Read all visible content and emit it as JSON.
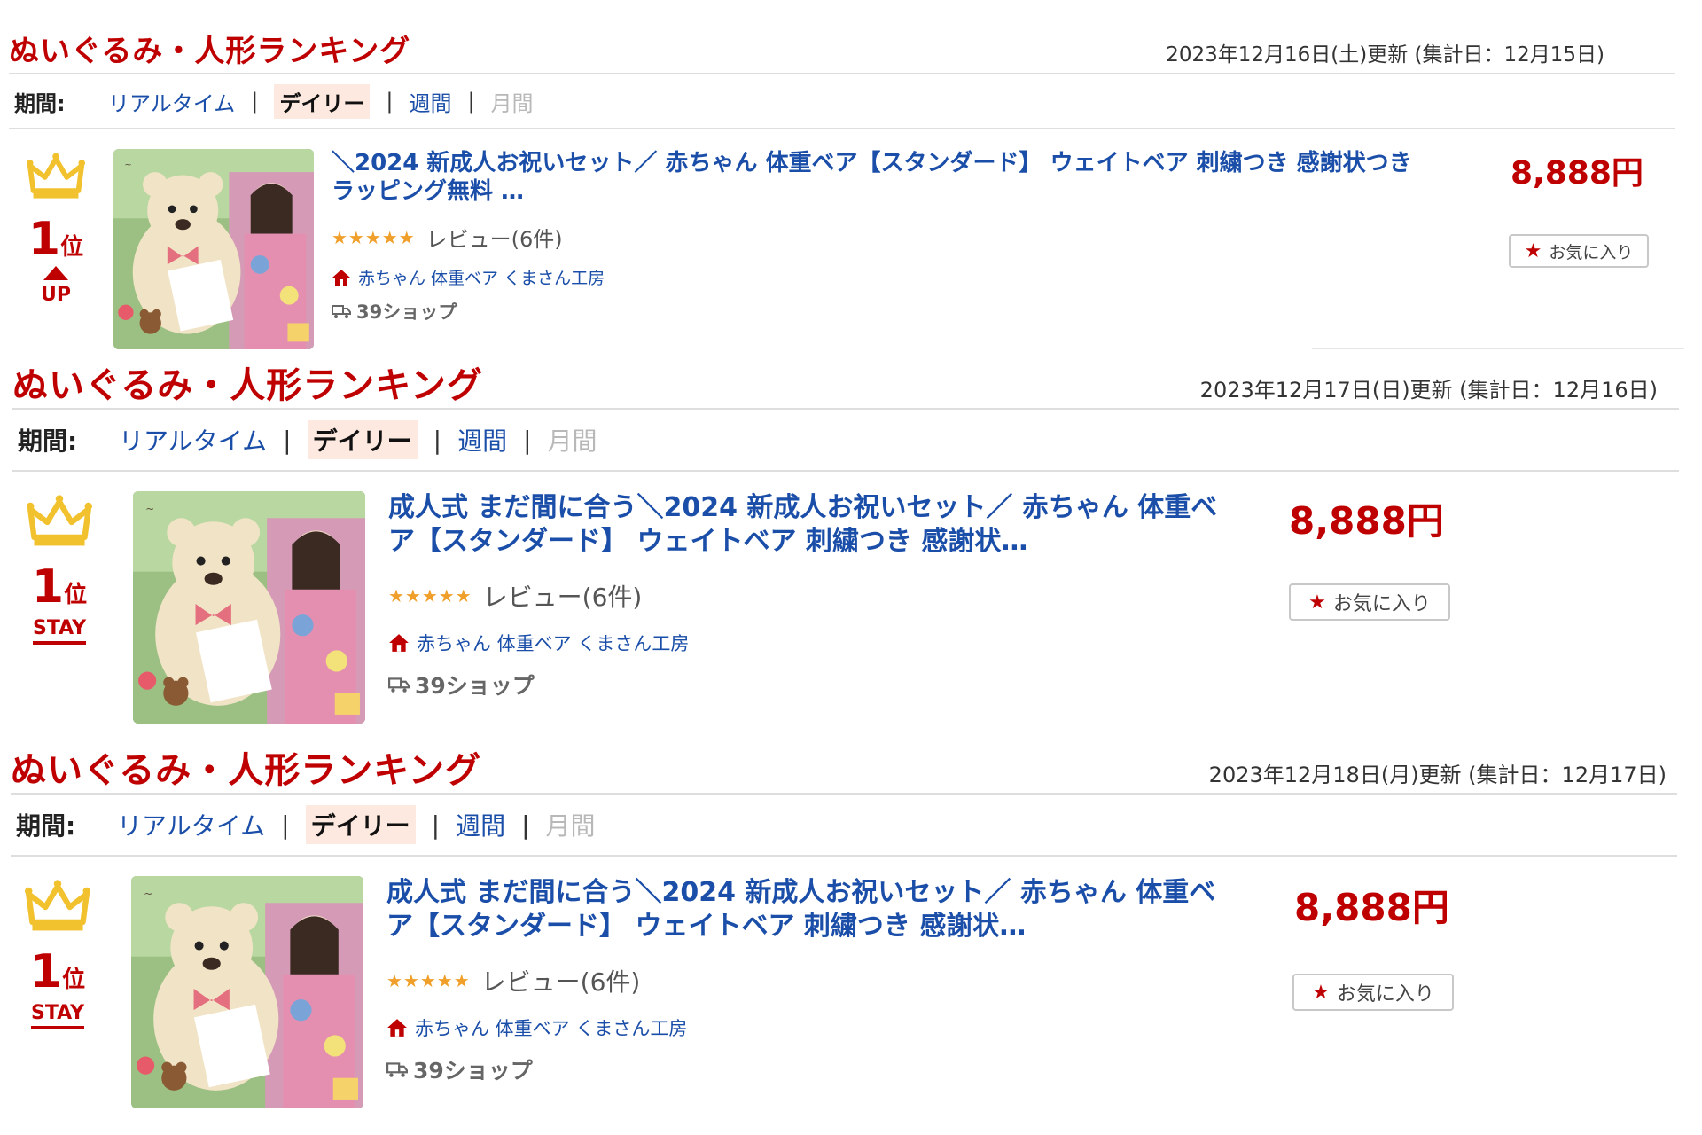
{
  "rankings": [
    {
      "title": "ぬいぐるみ・人形ランキング",
      "updated": "2023年12月16日(土)更新 (集計日：12月15日)",
      "period_label": "期間:",
      "tabs": [
        "リアルタイム",
        "デイリー",
        "週間",
        "月間"
      ],
      "item": {
        "rank": "1",
        "rank_unit": "位",
        "movement": "UP",
        "name": "＼2024 新成人お祝いセット／ 赤ちゃん 体重ベア【スタンダード】 ウェイトベア 刺繍つき 感謝状つき ラッピング無料 …",
        "stars": "★★★★★",
        "review": "レビュー(6件)",
        "shop": "赤ちゃん 体重ベア くまさん工房",
        "shipping": "39ショップ",
        "price": "8,888円",
        "favorite": "お気に入り"
      }
    },
    {
      "title": "ぬいぐるみ・人形ランキング",
      "updated": "2023年12月17日(日)更新 (集計日：12月16日)",
      "period_label": "期間:",
      "tabs": [
        "リアルタイム",
        "デイリー",
        "週間",
        "月間"
      ],
      "item": {
        "rank": "1",
        "rank_unit": "位",
        "movement": "STAY",
        "name": "成人式 まだ間に合う＼2024 新成人お祝いセット／ 赤ちゃん 体重ベア【スタンダード】 ウェイトベア 刺繍つき 感謝状…",
        "stars": "★★★★★",
        "review": "レビュー(6件)",
        "shop": "赤ちゃん 体重ベア くまさん工房",
        "shipping": "39ショップ",
        "price": "8,888円",
        "favorite": "お気に入り"
      }
    },
    {
      "title": "ぬいぐるみ・人形ランキング",
      "updated": "2023年12月18日(月)更新 (集計日：12月17日)",
      "period_label": "期間:",
      "tabs": [
        "リアルタイム",
        "デイリー",
        "週間",
        "月間"
      ],
      "item": {
        "rank": "1",
        "rank_unit": "位",
        "movement": "STAY",
        "name": "成人式 まだ間に合う＼2024 新成人お祝いセット／ 赤ちゃん 体重ベア【スタンダード】 ウェイトベア 刺繍つき 感謝状…",
        "stars": "★★★★★",
        "review": "レビュー(6件)",
        "shop": "赤ちゃん 体重ベア くまさん工房",
        "shipping": "39ショップ",
        "price": "8,888円",
        "favorite": "お気に入り"
      }
    }
  ],
  "icons": {
    "crown": "crown-icon",
    "shop": "house-icon",
    "shipping": "truck-icon",
    "favorite": "star-icon"
  },
  "colors": {
    "accent_red": "#bf0000",
    "link_blue": "#1a4ea8",
    "crown_gold": "#f2c12e",
    "star_orange": "#f0a02a",
    "current_tab_bg": "#fde9df"
  }
}
